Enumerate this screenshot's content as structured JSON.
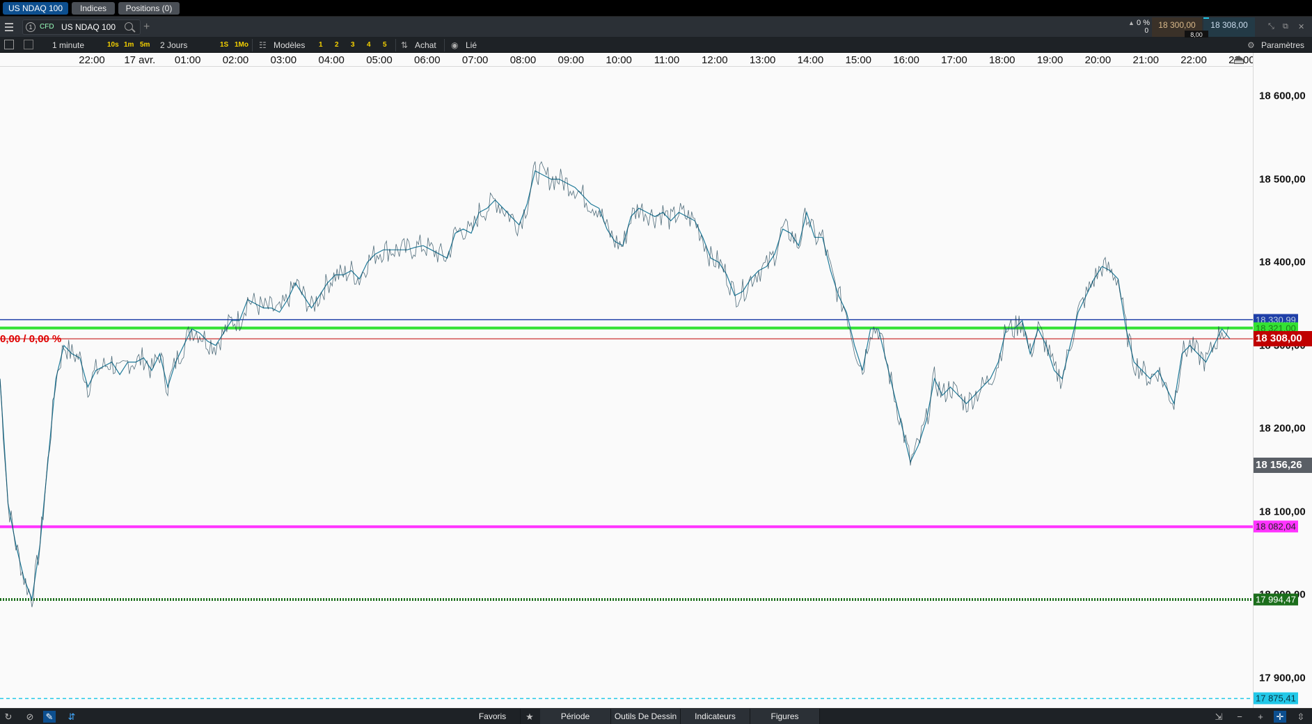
{
  "tabs": [
    {
      "label": "US NDAQ 100",
      "active": true
    },
    {
      "label": "Indices",
      "active": false
    },
    {
      "label": "Positions (0)",
      "active": false
    }
  ],
  "instrument": {
    "slot": "1",
    "type": "CFD",
    "name": "US NDAQ 100",
    "change_pct": "0 %",
    "change_pts": "0",
    "bid": "18 300,00",
    "ask": "18 308,00",
    "spread": "8,00"
  },
  "toolbar": {
    "interval": "1 minute",
    "quick_intervals": [
      "10s",
      "1m",
      "5m"
    ],
    "range": "2 Jours",
    "quick_ranges": [
      "1S",
      "1Mo"
    ],
    "templates_label": "Modèles",
    "template_slots": [
      "1",
      "2",
      "3",
      "4",
      "5"
    ],
    "trade_label": "Achat",
    "link_label": "Lié",
    "settings_label": "Paramètres"
  },
  "time_axis": [
    "22:00",
    "17 avr.",
    "01:00",
    "02:00",
    "03:00",
    "04:00",
    "05:00",
    "06:00",
    "07:00",
    "08:00",
    "09:00",
    "10:00",
    "11:00",
    "12:00",
    "13:00",
    "14:00",
    "15:00",
    "16:00",
    "17:00",
    "18:00",
    "19:00",
    "20:00",
    "21:00",
    "22:00",
    "23:00"
  ],
  "price_axis": [
    "18 600,00",
    "18 500,00",
    "18 400,00",
    "18 300,00",
    "18 200,00",
    "18 100,00",
    "18 000,00",
    "17 900,00"
  ],
  "chart_note": "0,00 / 0,00 %",
  "levels": {
    "blue": "18 330,99",
    "green": "18 321,00",
    "last": "18 308,00",
    "crosshair": "18 156,26",
    "magenta": "18 082,04",
    "dotted_green": "17 994,47",
    "cyan": "17 875,41"
  },
  "colors": {
    "line": "#1f7a99",
    "blue_level": "#1f3fa8",
    "green_level": "#34e234",
    "last_price": "#c00000",
    "magenta_level": "#ff33ff",
    "dotted_green": "#1b6e1b",
    "cyan_level": "#22c8e8"
  },
  "chart_data": {
    "type": "line",
    "x": [
      "21:50",
      "22:00",
      "22:10",
      "22:20",
      "22:30",
      "22:40",
      "22:50",
      "23:00",
      "23:10",
      "23:20",
      "23:30",
      "23:40",
      "23:50",
      "00:00",
      "00:10",
      "00:20",
      "00:30",
      "00:40",
      "00:50",
      "01:00",
      "01:10",
      "01:20",
      "01:30",
      "01:40",
      "01:50",
      "02:00",
      "02:10",
      "02:20",
      "02:30",
      "02:40",
      "02:50",
      "03:00",
      "03:10",
      "03:20",
      "03:30",
      "03:40",
      "03:50",
      "04:00",
      "04:10",
      "04:20",
      "04:30",
      "04:40",
      "04:50",
      "05:00",
      "05:10",
      "05:20",
      "05:30",
      "05:40",
      "05:50",
      "06:00",
      "06:10",
      "06:20",
      "06:30",
      "06:40",
      "06:50",
      "07:00",
      "07:10",
      "07:20",
      "07:30",
      "07:40",
      "07:50",
      "08:00",
      "08:10",
      "08:20",
      "08:30",
      "08:40",
      "08:50",
      "09:00",
      "09:10",
      "09:20",
      "09:30",
      "09:40",
      "09:50",
      "10:00",
      "10:10",
      "10:20",
      "10:30",
      "10:40",
      "10:50",
      "11:00",
      "11:10",
      "11:20",
      "11:30",
      "11:40",
      "11:50",
      "12:00",
      "12:10",
      "12:20",
      "12:30",
      "12:40",
      "12:50",
      "13:00",
      "13:10",
      "13:20",
      "13:30",
      "13:40",
      "13:50",
      "14:00",
      "14:10",
      "14:20",
      "14:30",
      "14:40",
      "14:50",
      "15:00",
      "15:10",
      "15:20",
      "15:30",
      "15:40",
      "15:50",
      "16:00",
      "16:10",
      "16:20",
      "16:30",
      "16:40",
      "16:50",
      "17:00",
      "17:10",
      "17:20",
      "17:30",
      "17:40",
      "17:50",
      "18:00",
      "18:10",
      "18:20",
      "18:30",
      "18:40",
      "18:50",
      "19:00",
      "19:10",
      "19:20",
      "19:30",
      "19:40",
      "19:50",
      "20:00",
      "20:10",
      "20:20",
      "20:30",
      "20:40",
      "20:50",
      "21:00",
      "21:10",
      "21:20",
      "21:30",
      "21:40",
      "21:50",
      "22:00",
      "22:10",
      "22:20",
      "22:30",
      "22:40"
    ],
    "series": [
      {
        "values": [
          18260,
          18110,
          18060,
          18020,
          17995,
          18060,
          18160,
          18260,
          18300,
          18290,
          18285,
          18250,
          18270,
          18275,
          18280,
          18265,
          18280,
          18280,
          18285,
          18270,
          18290,
          18250,
          18280,
          18300,
          18320,
          18315,
          18305,
          18300,
          18315,
          18330,
          18330,
          18355,
          18350,
          18345,
          18345,
          18340,
          18355,
          18375,
          18360,
          18345,
          18360,
          18375,
          18385,
          18385,
          18390,
          18380,
          18400,
          18410,
          18415,
          18415,
          18415,
          18415,
          18418,
          18420,
          18415,
          18410,
          18405,
          18435,
          18440,
          18435,
          18460,
          18465,
          18475,
          18465,
          18455,
          18445,
          18470,
          18510,
          18505,
          18500,
          18500,
          18495,
          18490,
          18480,
          18470,
          18465,
          18440,
          18425,
          18420,
          18455,
          18465,
          18460,
          18455,
          18460,
          18450,
          18460,
          18455,
          18450,
          18430,
          18405,
          18400,
          18385,
          18360,
          18365,
          18380,
          18390,
          18395,
          18410,
          18440,
          18435,
          18420,
          18460,
          18430,
          18430,
          18390,
          18360,
          18340,
          18300,
          18270,
          18320,
          18320,
          18280,
          18240,
          18200,
          18160,
          18180,
          18210,
          18260,
          18240,
          18250,
          18240,
          18230,
          18240,
          18250,
          18260,
          18280,
          18320,
          18320,
          18330,
          18290,
          18320,
          18300,
          18270,
          18260,
          18300,
          18340,
          18360,
          18380,
          18395,
          18390,
          18380,
          18320,
          18280,
          18270,
          18260,
          18270,
          18250,
          18230,
          18290,
          18300,
          18290,
          18280,
          18300,
          18320,
          18308
        ]
      }
    ],
    "ylim": [
      17855,
      18640
    ],
    "grid": false,
    "levels": [
      18330.99,
      18321.0,
      18308.0,
      18082.04,
      17994.47,
      17875.41
    ]
  }
}
